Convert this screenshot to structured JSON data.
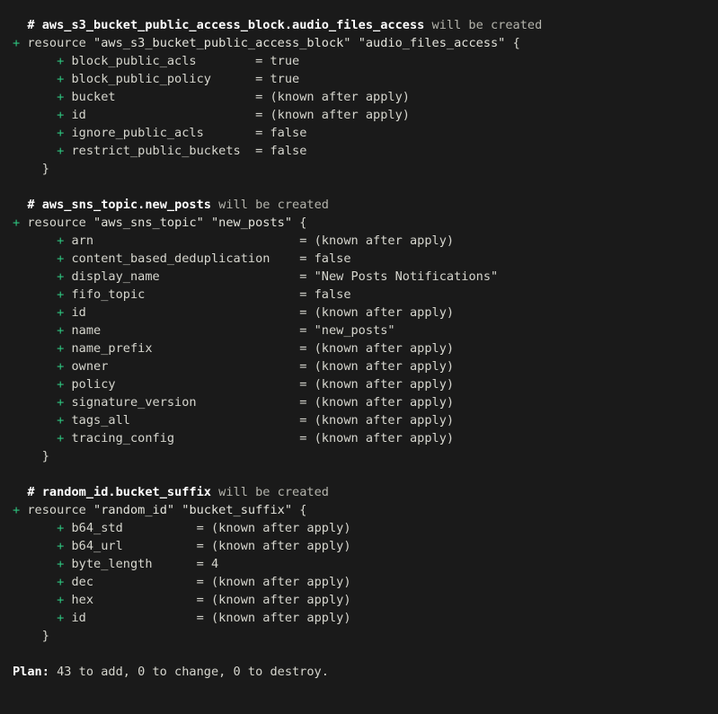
{
  "terminal": {
    "program": "terraform plan",
    "background_color": "#1a1a1a",
    "foreground_color": "#d6d6ce",
    "accent_add_color": "#2ec27e",
    "comment_dim_color": "#b4b4ac"
  },
  "blocks": [
    {
      "comment_marker": "#",
      "resource_address": "aws_s3_bucket_public_access_block.audio_files_access",
      "comment_suffix": "will be created",
      "action_sign": "+",
      "keyword": "resource",
      "type_string": "\"aws_s3_bucket_public_access_block\"",
      "name_string": "\"audio_files_access\"",
      "open_brace": "{",
      "close_brace": "}",
      "attr_column": 25,
      "attributes": [
        {
          "sign": "+",
          "name": "block_public_acls",
          "eq": "=",
          "value": "true"
        },
        {
          "sign": "+",
          "name": "block_public_policy",
          "eq": "=",
          "value": "true"
        },
        {
          "sign": "+",
          "name": "bucket",
          "eq": "=",
          "value": "(known after apply)"
        },
        {
          "sign": "+",
          "name": "id",
          "eq": "=",
          "value": "(known after apply)"
        },
        {
          "sign": "+",
          "name": "ignore_public_acls",
          "eq": "=",
          "value": "false"
        },
        {
          "sign": "+",
          "name": "restrict_public_buckets",
          "eq": "=",
          "value": "false"
        }
      ]
    },
    {
      "comment_marker": "#",
      "resource_address": "aws_sns_topic.new_posts",
      "comment_suffix": "will be created",
      "action_sign": "+",
      "keyword": "resource",
      "type_string": "\"aws_sns_topic\"",
      "name_string": "\"new_posts\"",
      "open_brace": "{",
      "close_brace": "}",
      "attr_column": 31,
      "attributes": [
        {
          "sign": "+",
          "name": "arn",
          "eq": "=",
          "value": "(known after apply)"
        },
        {
          "sign": "+",
          "name": "content_based_deduplication",
          "eq": "=",
          "value": "false"
        },
        {
          "sign": "+",
          "name": "display_name",
          "eq": "=",
          "value": "\"New Posts Notifications\""
        },
        {
          "sign": "+",
          "name": "fifo_topic",
          "eq": "=",
          "value": "false"
        },
        {
          "sign": "+",
          "name": "id",
          "eq": "=",
          "value": "(known after apply)"
        },
        {
          "sign": "+",
          "name": "name",
          "eq": "=",
          "value": "\"new_posts\""
        },
        {
          "sign": "+",
          "name": "name_prefix",
          "eq": "=",
          "value": "(known after apply)"
        },
        {
          "sign": "+",
          "name": "owner",
          "eq": "=",
          "value": "(known after apply)"
        },
        {
          "sign": "+",
          "name": "policy",
          "eq": "=",
          "value": "(known after apply)"
        },
        {
          "sign": "+",
          "name": "signature_version",
          "eq": "=",
          "value": "(known after apply)"
        },
        {
          "sign": "+",
          "name": "tags_all",
          "eq": "=",
          "value": "(known after apply)"
        },
        {
          "sign": "+",
          "name": "tracing_config",
          "eq": "=",
          "value": "(known after apply)"
        }
      ]
    },
    {
      "comment_marker": "#",
      "resource_address": "random_id.bucket_suffix",
      "comment_suffix": "will be created",
      "action_sign": "+",
      "keyword": "resource",
      "type_string": "\"random_id\"",
      "name_string": "\"bucket_suffix\"",
      "open_brace": "{",
      "close_brace": "}",
      "attr_column": 17,
      "attributes": [
        {
          "sign": "+",
          "name": "b64_std",
          "eq": "=",
          "value": "(known after apply)"
        },
        {
          "sign": "+",
          "name": "b64_url",
          "eq": "=",
          "value": "(known after apply)"
        },
        {
          "sign": "+",
          "name": "byte_length",
          "eq": "=",
          "value": "4"
        },
        {
          "sign": "+",
          "name": "dec",
          "eq": "=",
          "value": "(known after apply)"
        },
        {
          "sign": "+",
          "name": "hex",
          "eq": "=",
          "value": "(known after apply)"
        },
        {
          "sign": "+",
          "name": "id",
          "eq": "=",
          "value": "(known after apply)"
        }
      ]
    }
  ],
  "plan_summary": {
    "label": "Plan:",
    "text": " 43 to add, 0 to change, 0 to destroy.",
    "add_count": 43,
    "change_count": 0,
    "destroy_count": 0
  }
}
